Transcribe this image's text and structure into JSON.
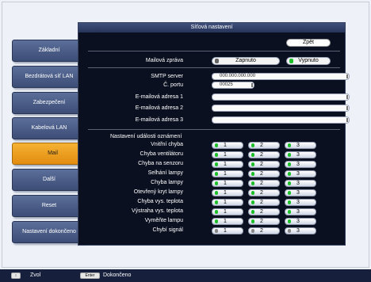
{
  "panel": {
    "title": "Síťová nastavení",
    "back_label": "Zpět"
  },
  "sidebar": {
    "items": [
      {
        "label": "Základní"
      },
      {
        "label": "Bezdrátová síť LAN"
      },
      {
        "label": "Zabezpečení"
      },
      {
        "label": "Kabelová LAN"
      },
      {
        "label": "Mail",
        "active": true
      },
      {
        "label": "Další"
      },
      {
        "label": "Reset"
      },
      {
        "label": "Nastavení dokončeno"
      }
    ]
  },
  "mail": {
    "label": "Mailová zpráva",
    "on_label": "Zapnuto",
    "off_label": "Vypnuto",
    "selected": "Vypnuto"
  },
  "smtp": {
    "label": "SMTP server",
    "value": "000.000.000.000"
  },
  "port": {
    "label": "Č. portu",
    "value": "00025"
  },
  "emails": [
    {
      "label": "E-mailová adresa 1",
      "value": ""
    },
    {
      "label": "E-mailová adresa 2",
      "value": ""
    },
    {
      "label": "E-mailová adresa 3",
      "value": ""
    }
  ],
  "events": {
    "heading": "Nastavení události oznámení",
    "columns": [
      "1",
      "2",
      "3"
    ],
    "rows": [
      {
        "label": "Vnitřní chyba"
      },
      {
        "label": "Chyba ventilátoru"
      },
      {
        "label": "Chyba na senzoru"
      },
      {
        "label": "Selhání lampy"
      },
      {
        "label": "Chyba lampy"
      },
      {
        "label": "Otevřený kryt lampy"
      },
      {
        "label": "Chyba vys. teplota"
      },
      {
        "label": "Výstraha vys. teplota"
      },
      {
        "label": "Vyměňte lampu"
      },
      {
        "label": "Chybí signál"
      }
    ]
  },
  "statusbar": {
    "select_key": "↕",
    "select_label": "Zvol",
    "enter_key": "Enter",
    "enter_label": "Dokončeno"
  }
}
